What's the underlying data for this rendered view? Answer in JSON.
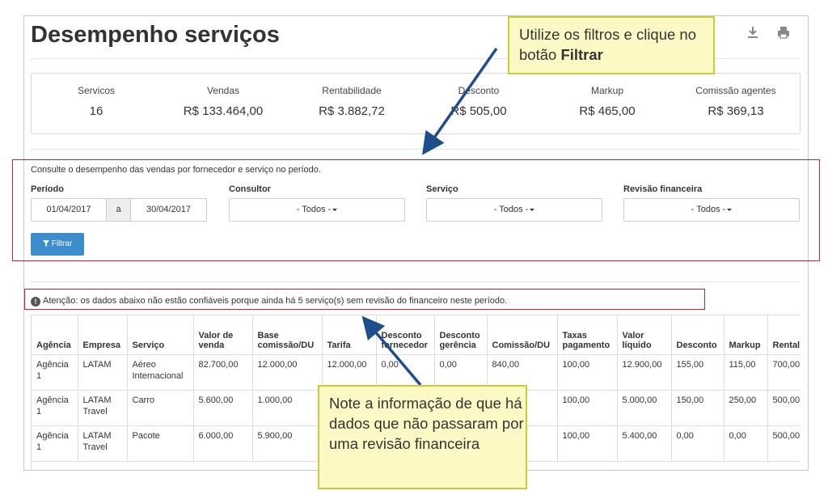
{
  "page": {
    "title": "Desempenho serviços"
  },
  "toolbar": {
    "download_icon": "download-icon",
    "print_icon": "printer-icon"
  },
  "stats": [
    {
      "label": "Servicos",
      "value": "16"
    },
    {
      "label": "Vendas",
      "value": "R$ 133.464,00"
    },
    {
      "label": "Rentabilidade",
      "value": "R$ 3.882,72"
    },
    {
      "label": "Desconto",
      "value": "R$ 505,00"
    },
    {
      "label": "Markup",
      "value": "R$ 465,00"
    },
    {
      "label": "Comissão agentes",
      "value": "R$ 369,13"
    }
  ],
  "filters": {
    "description": "Consulte o desempenho das vendas por fornecedor e serviço no período.",
    "period_label": "Período",
    "date_from": "01/04/2017",
    "date_separator": "a",
    "date_to": "30/04/2017",
    "consultor_label": "Consultor",
    "consultor_value": "- Todos -",
    "servico_label": "Serviço",
    "servico_value": "- Todos -",
    "revisao_label": "Revisão financeira",
    "revisao_value": "- Todos -",
    "filter_button": "Filtrar"
  },
  "warning": {
    "icon": "exclamation-circle-icon",
    "text": "Atenção: os dados abaixo não estão confiáveis porque ainda há 5 serviço(s) sem revisão do financeiro neste período."
  },
  "table": {
    "headers": [
      "Agência",
      "Empresa",
      "Serviço",
      "Valor de venda",
      "Base comissão/DU",
      "Tarifa",
      "Desconto fornecedor",
      "Desconto gerência",
      "Comissão/DU",
      "Taxas pagamento",
      "Valor líquido",
      "Desconto",
      "Markup",
      "Rental"
    ],
    "rows": [
      [
        "Agência 1",
        "LATAM",
        "Aéreo Internacional",
        "82.700,00",
        "12.000,00",
        "12.000,00",
        "0,00",
        "0,00",
        "840,00",
        "100,00",
        "12.900,00",
        "155,00",
        "115,00",
        "700,00"
      ],
      [
        "Agência 1",
        "LATAM Travel",
        "Carro",
        "5.600,00",
        "1.000,00",
        "",
        "",
        "",
        "",
        "100,00",
        "5.000,00",
        "150,00",
        "250,00",
        "500,00"
      ],
      [
        "Agência 1",
        "LATAM Travel",
        "Pacote",
        "6.000,00",
        "5.900,00",
        "",
        "",
        "",
        "",
        "100,00",
        "5.400,00",
        "0,00",
        "0,00",
        "500,00"
      ]
    ]
  },
  "callouts": {
    "top_text": "Utilize os filtros e clique no botão ",
    "top_bold": "Filtrar",
    "bottom_text": "Note a informação de que há dados que não passaram por uma revisão financeira"
  },
  "colors": {
    "accent": "#3c8dcb",
    "highlight_border": "#d3202e",
    "callout_bg": "#fdf9c4",
    "callout_border": "#c9cc3a",
    "arrow": "#1f4e8c"
  }
}
